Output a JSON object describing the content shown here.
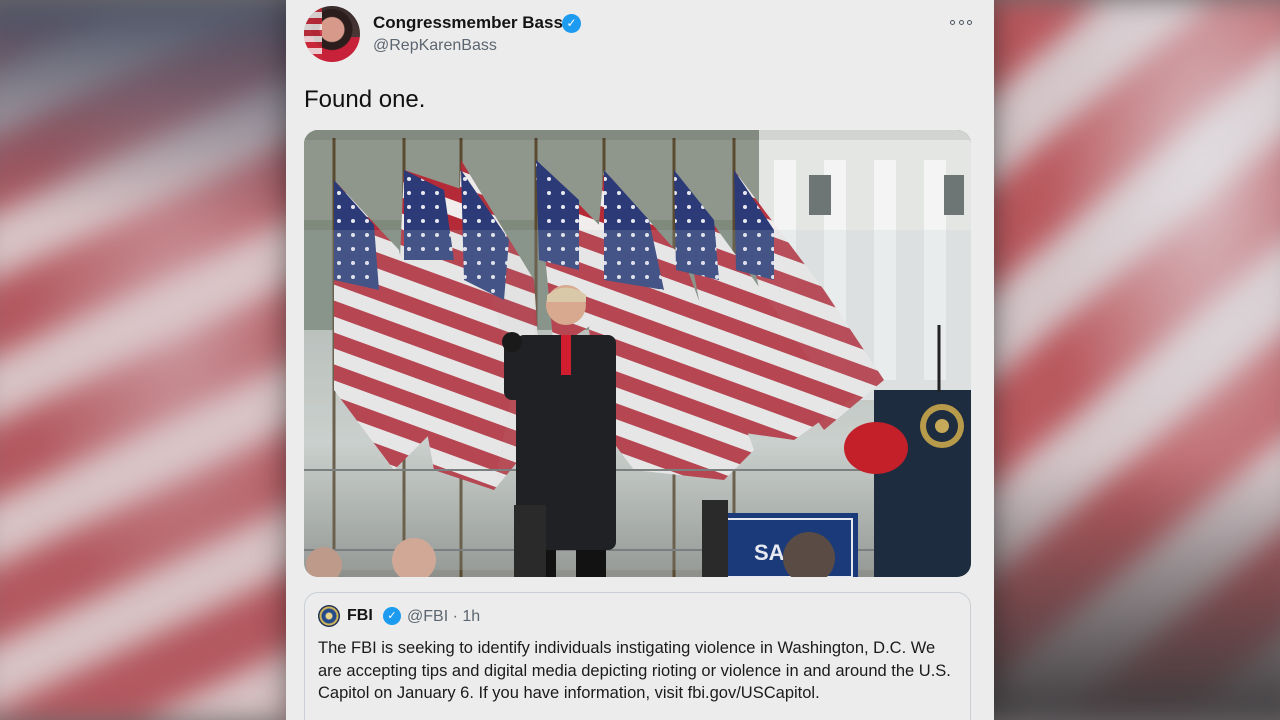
{
  "tweet": {
    "author_name": "Congressmember Bass",
    "author_handle": "@RepKarenBass",
    "text": "Found one.",
    "more_icon": "more-horizontal-icon",
    "verified_icon": "verified-badge-icon"
  },
  "media": {
    "description_icon": "photo"
  },
  "quoted_tweet": {
    "author_name": "FBI",
    "author_handle": "@FBI",
    "separator": "·",
    "time": "1h",
    "text": "The FBI is seeking to identify individuals instigating violence in Washington, D.C. We are accepting tips and digital media depicting rioting or violence in and around the U.S. Capitol on January 6. If you have information, visit fbi.gov/USCapitol."
  },
  "colors": {
    "card_bg": "#ececec",
    "verified_blue": "#1d9bf0",
    "handle_gray": "#5c6670"
  }
}
